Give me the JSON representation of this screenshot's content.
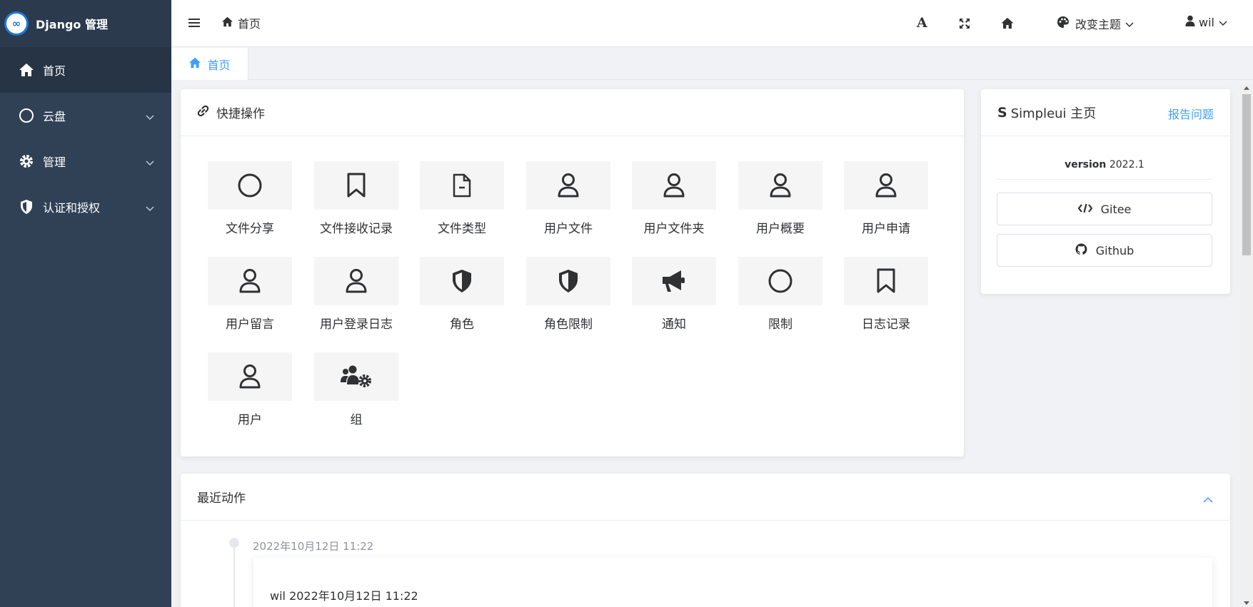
{
  "app": {
    "title": "Django 管理",
    "logo_glyph": "∞"
  },
  "sidebar": {
    "items": [
      {
        "label": "首页",
        "icon": "home-icon",
        "active": true
      },
      {
        "label": "云盘",
        "icon": "circle-icon",
        "has_children": true
      },
      {
        "label": "管理",
        "icon": "gear-icon",
        "has_children": true
      },
      {
        "label": "认证和授权",
        "icon": "shield-icon",
        "has_children": true
      }
    ]
  },
  "header": {
    "breadcrumb": "首页",
    "font_icon_glyph": "A",
    "theme_label": "改变主题",
    "user_name": "wil"
  },
  "tabs": [
    {
      "label": "首页",
      "active": true
    }
  ],
  "quick_actions": {
    "title": "快捷操作",
    "items": [
      {
        "label": "文件分享",
        "icon": "circle-icon"
      },
      {
        "label": "文件接收记录",
        "icon": "bookmark-icon"
      },
      {
        "label": "文件类型",
        "icon": "file-icon"
      },
      {
        "label": "用户文件",
        "icon": "user-icon"
      },
      {
        "label": "用户文件夹",
        "icon": "user-icon"
      },
      {
        "label": "用户概要",
        "icon": "user-icon"
      },
      {
        "label": "用户申请",
        "icon": "user-icon"
      },
      {
        "label": "用户留言",
        "icon": "user-icon"
      },
      {
        "label": "用户登录日志",
        "icon": "user-icon"
      },
      {
        "label": "角色",
        "icon": "shield-half-icon"
      },
      {
        "label": "角色限制",
        "icon": "shield-half-icon"
      },
      {
        "label": "通知",
        "icon": "bullhorn-icon"
      },
      {
        "label": "限制",
        "icon": "circle-icon"
      },
      {
        "label": "日志记录",
        "icon": "bookmark-icon"
      },
      {
        "label": "用户",
        "icon": "user-icon"
      },
      {
        "label": "组",
        "icon": "users-cog-icon"
      }
    ]
  },
  "simpleui": {
    "logo_letter": "S",
    "title": "Simpleui 主页",
    "report_link": "报告问题",
    "version_label": "version",
    "version_value": "2022.1",
    "gitee_label": "Gitee",
    "github_label": "Github"
  },
  "recent": {
    "title": "最近动作",
    "entries": [
      {
        "time": "2022年10月12日 11:22",
        "text": "wil 2022年10月12日 11:22"
      }
    ]
  },
  "colors": {
    "sidebar_bg": "#304156",
    "accent": "#409eff"
  }
}
